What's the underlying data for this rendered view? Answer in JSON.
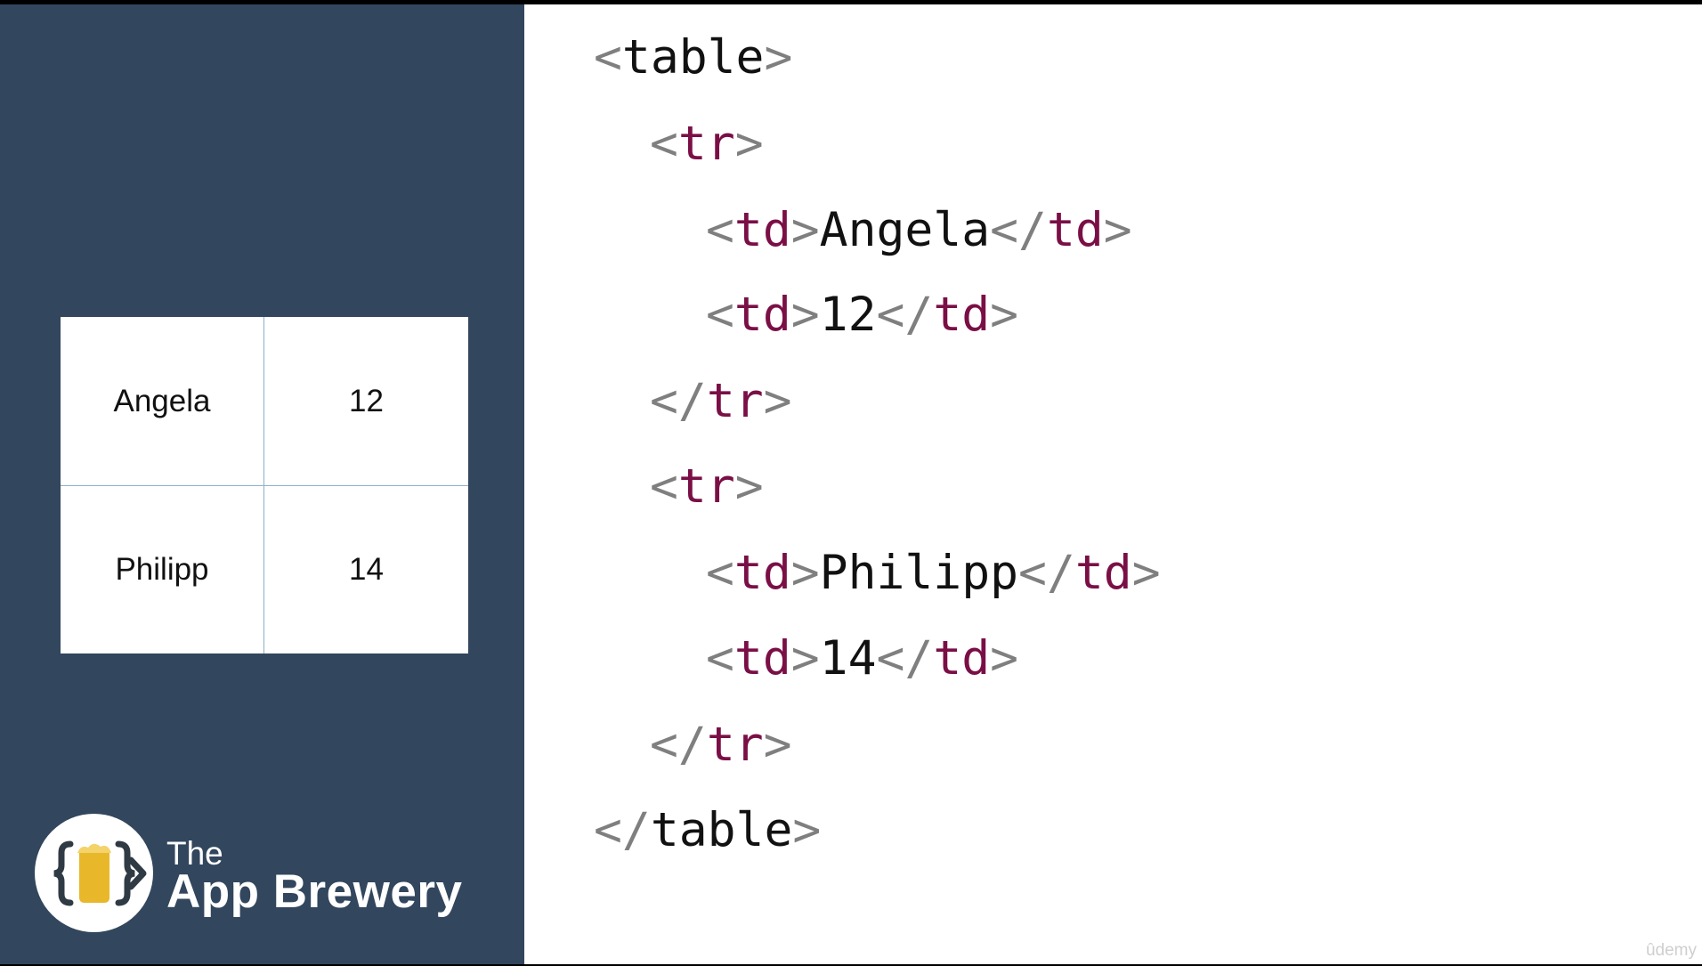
{
  "preview_table": {
    "rows": [
      {
        "name": "Angela",
        "value": "12"
      },
      {
        "name": "Philipp",
        "value": "14"
      }
    ]
  },
  "brand": {
    "the": "The",
    "name": "App Brewery"
  },
  "code": {
    "lt": "<",
    "gt": ">",
    "close_lt": "</",
    "table_tag": "table",
    "row_tag": "tr",
    "cell_tag": "td",
    "row1_cell1": "Angela",
    "row1_cell2": "12",
    "row2_cell1": "Philipp",
    "row2_cell2": "14"
  },
  "watermark": "ûdemy",
  "colors": {
    "left_panel": "#32465d",
    "tag_accent": "#7a0f46",
    "punctuation": "#7f7f7f",
    "logo_yellow": "#e8b82a"
  }
}
